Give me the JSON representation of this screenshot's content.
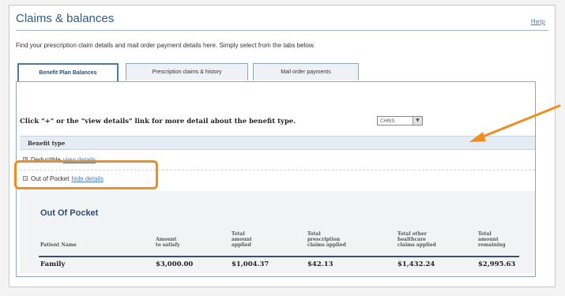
{
  "page": {
    "title": "Claims & balances",
    "help": "Help",
    "subtitle": "Find your prescription claim details and mail order payment details here. Simply select from the tabs below."
  },
  "tabs": [
    {
      "label": "Benefit Plan Balances",
      "active": true
    },
    {
      "label": "Prescription claims & history",
      "active": false
    },
    {
      "label": "Mail order payments",
      "active": false
    }
  ],
  "panel": {
    "instruction": "Click \"+\" or the \"view details\" link for more detail about the benefit type.",
    "select_value": "CHRIS",
    "benefit_header": "Benefit type",
    "rows": [
      {
        "expander": "+",
        "label": "Deductible",
        "link": "view details"
      },
      {
        "expander": "−",
        "label": "Out of Pocket",
        "link": "hide details"
      }
    ]
  },
  "details": {
    "title": "Out Of Pocket",
    "columns": [
      [
        "Patient Name"
      ],
      [
        "Amount",
        "to satisfy"
      ],
      [
        "Total",
        "amount",
        "applied"
      ],
      [
        "Total",
        "prescription",
        "claims applied"
      ],
      [
        "Total other",
        "healthcare",
        "claims applied"
      ],
      [
        "Total",
        "amount",
        "remaining"
      ]
    ],
    "row": [
      "Family",
      "$3,000.00",
      "$1,004.37",
      "$42.13",
      "$1,432.24",
      "$2,995.63"
    ]
  },
  "colors": {
    "callout": "#f28c1c",
    "title": "#2d5d86",
    "link": "#4a7fb2"
  }
}
